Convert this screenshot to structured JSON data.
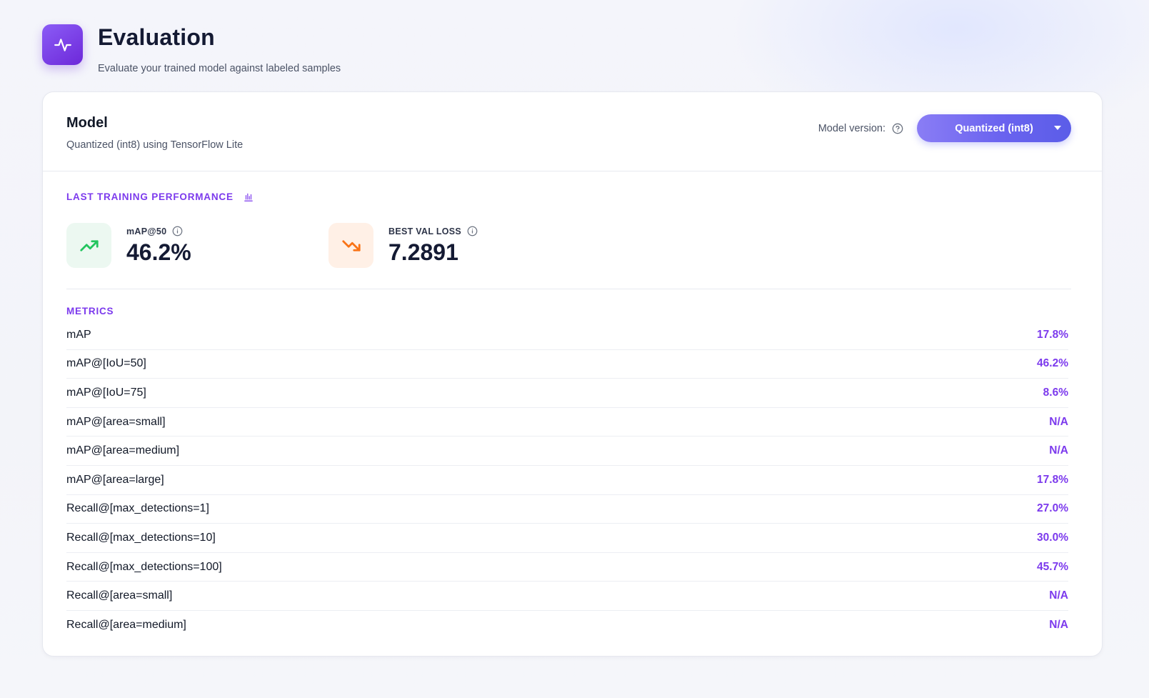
{
  "header": {
    "title": "Evaluation",
    "subtitle": "Evaluate your trained model against labeled samples",
    "icon": "pulse-icon",
    "icon_gradient": [
      "#8b5cf6",
      "#6d28d9"
    ]
  },
  "model": {
    "title": "Model",
    "description": "Quantized (int8) using TensorFlow Lite",
    "version_label": "Model version:",
    "version_selected": "Quantized (int8)"
  },
  "performance": {
    "label": "LAST TRAINING PERFORMANCE",
    "stats": [
      {
        "label": "mAP@50",
        "value": "46.2%",
        "icon": "trending-up-icon",
        "color": "#22c55e",
        "bg": "#ecf8f1"
      },
      {
        "label": "BEST VAL LOSS",
        "value": "7.2891",
        "icon": "trending-down-icon",
        "color": "#f97316",
        "bg": "#fff0e6"
      }
    ]
  },
  "metrics": {
    "label": "METRICS",
    "rows": [
      {
        "name": "mAP",
        "value": "17.8%"
      },
      {
        "name": "mAP@[IoU=50]",
        "value": "46.2%"
      },
      {
        "name": "mAP@[IoU=75]",
        "value": "8.6%"
      },
      {
        "name": "mAP@[area=small]",
        "value": "N/A"
      },
      {
        "name": "mAP@[area=medium]",
        "value": "N/A"
      },
      {
        "name": "mAP@[area=large]",
        "value": "17.8%"
      },
      {
        "name": "Recall@[max_detections=1]",
        "value": "27.0%"
      },
      {
        "name": "Recall@[max_detections=10]",
        "value": "30.0%"
      },
      {
        "name": "Recall@[max_detections=100]",
        "value": "45.7%"
      },
      {
        "name": "Recall@[area=small]",
        "value": "N/A"
      },
      {
        "name": "Recall@[area=medium]",
        "value": "N/A"
      }
    ]
  },
  "colors": {
    "accent": "#7c3aed",
    "button_gradient": [
      "#8a7df5",
      "#5b5de8"
    ]
  }
}
